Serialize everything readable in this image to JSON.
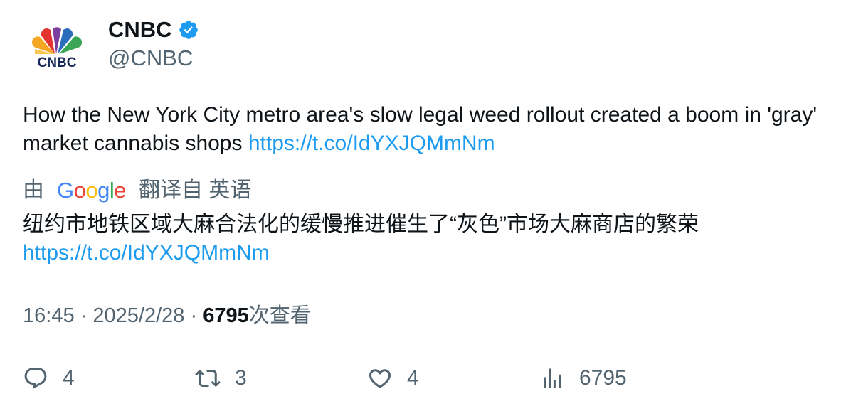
{
  "author": {
    "display_name": "CNBC",
    "handle": "@CNBC",
    "avatar_text": "CNBC",
    "verified_icon": "verified-badge-icon"
  },
  "tweet": {
    "text": "How the New York City metro area's slow legal weed rollout created a boom in 'gray' market cannabis shops",
    "link": "https://t.co/IdYXJQMmNm"
  },
  "translation": {
    "prefix": "由",
    "provider": "Google",
    "suffix": "翻译自 英语",
    "text": "纽约市地铁区域大麻合法化的缓慢推进催生了“灰色”市场大麻商店的繁荣",
    "link": "https://t.co/IdYXJQMmNm"
  },
  "meta": {
    "time": "16:45",
    "sep1": "·",
    "date": "2025/2/28",
    "sep2": "·",
    "views": "6795",
    "views_label": "次查看"
  },
  "actions": {
    "replies": "4",
    "retweets": "3",
    "likes": "4",
    "views": "6795"
  },
  "colors": {
    "link": "#1d9bf0",
    "secondary": "#536471",
    "primary": "#0f1419"
  }
}
